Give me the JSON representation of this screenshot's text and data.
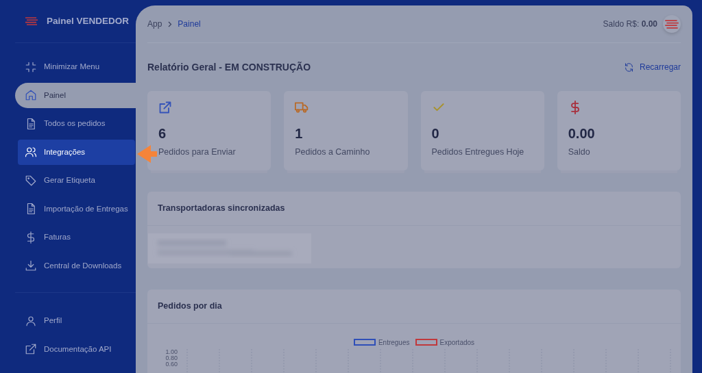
{
  "brand": {
    "title": "Painel VENDEDOR"
  },
  "sidebar": {
    "menu_items": [
      {
        "label": "Minimizar Menu",
        "selected": false,
        "highlighted": false
      },
      {
        "label": "Painel",
        "selected": true,
        "highlighted": false
      },
      {
        "label": "Todos os pedidos",
        "selected": false,
        "highlighted": false
      },
      {
        "label": "Integrações",
        "selected": false,
        "highlighted": true
      },
      {
        "label": "Gerar Etiqueta",
        "selected": false,
        "highlighted": false
      },
      {
        "label": "Importação de Entregas",
        "selected": false,
        "highlighted": false
      },
      {
        "label": "Faturas",
        "selected": false,
        "highlighted": false
      },
      {
        "label": "Central de Downloads",
        "selected": false,
        "highlighted": false
      }
    ],
    "footer_items": [
      {
        "label": "Perfil",
        "selected": false,
        "highlighted": false
      },
      {
        "label": "Documentação API",
        "selected": false,
        "highlighted": false
      }
    ]
  },
  "breadcrumb": [
    "App",
    "Painel"
  ],
  "balance": {
    "label": "Saldo R$:",
    "value": "0.00"
  },
  "page_title": "Relatório Geral - EM CONSTRUÇÃO",
  "reload_button": "Recarregar",
  "stats": [
    {
      "value": "6",
      "label": "Pedidos para Enviar",
      "color": "#3553b8"
    },
    {
      "value": "1",
      "label": "Pedidos a Caminho",
      "color": "#b86a28"
    },
    {
      "value": "0",
      "label": "Pedidos Entregues Hoje",
      "color": "#a8922c"
    },
    {
      "value": "0.00",
      "label": "Saldo",
      "color": "#a8303e"
    }
  ],
  "carriers_card": {
    "title": "Transportadoras sincronizadas"
  },
  "orders_chart": {
    "title": "Pedidos por dia",
    "legend": [
      {
        "label": "Entregues",
        "color": "#2f4fb8"
      },
      {
        "label": "Exportados",
        "color": "#c0383c"
      }
    ],
    "y_labels": [
      "1.00",
      "0.80",
      "0.60"
    ]
  }
}
